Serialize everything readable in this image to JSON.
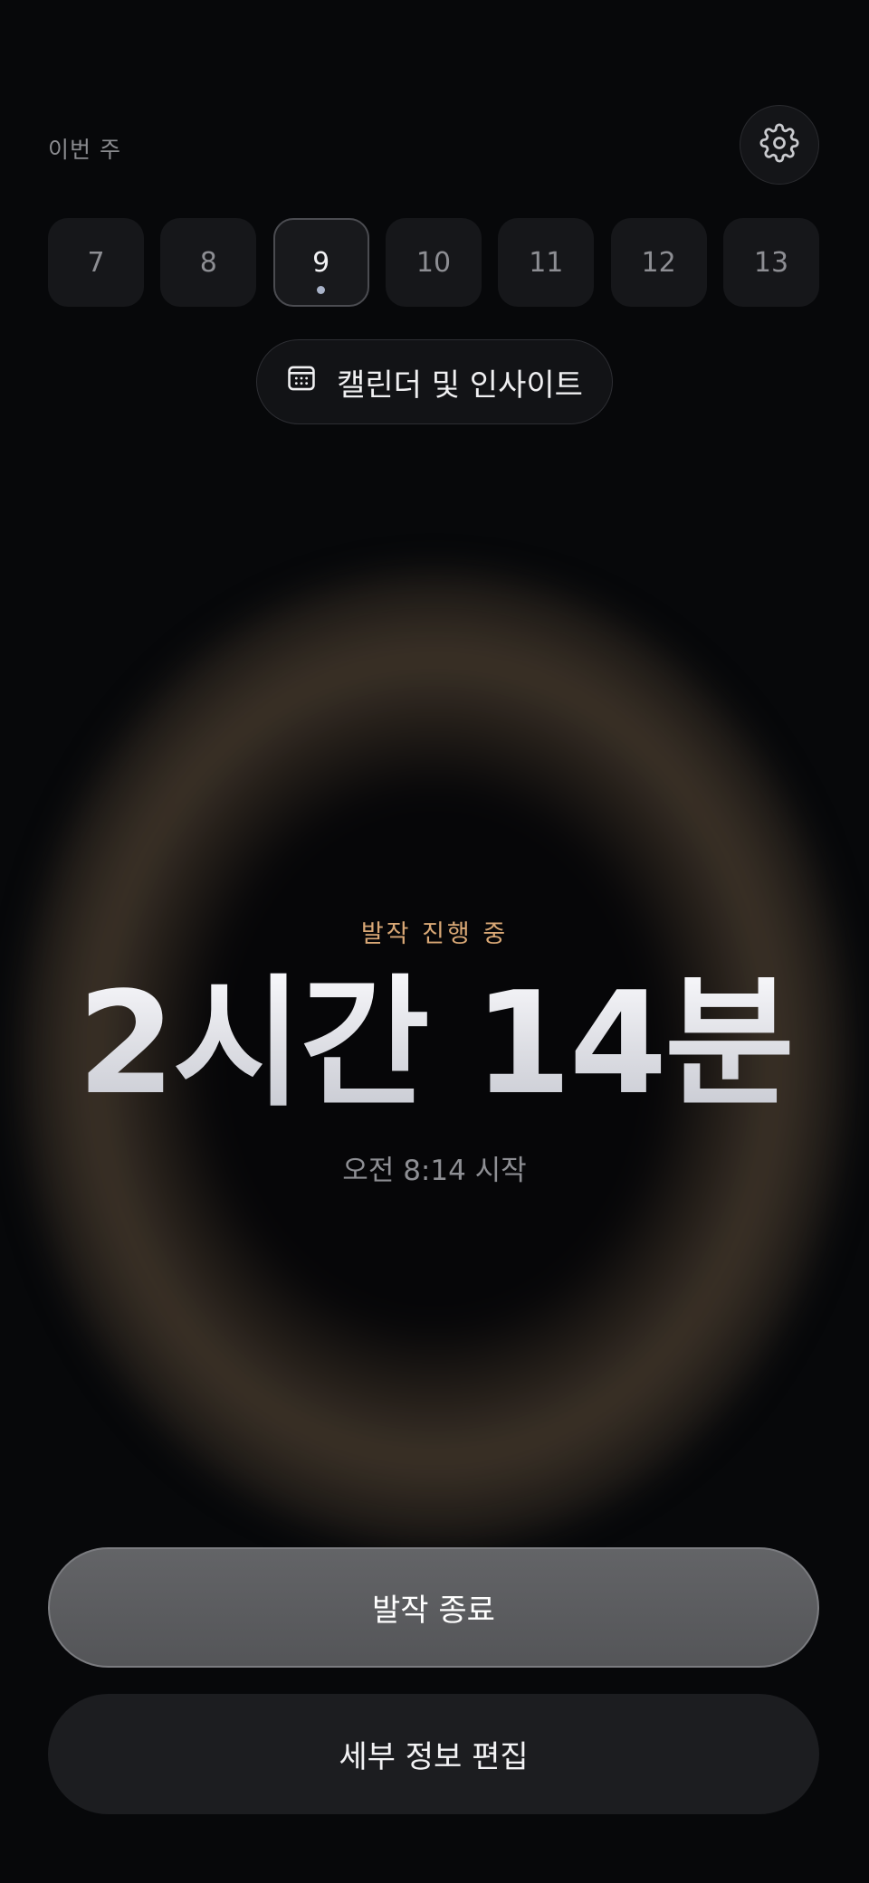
{
  "header": {
    "week_label": "이번 주",
    "settings_icon": "gear-icon"
  },
  "days": [
    {
      "label": "7",
      "active": false
    },
    {
      "label": "8",
      "active": false
    },
    {
      "label": "9",
      "active": true
    },
    {
      "label": "10",
      "active": false
    },
    {
      "label": "11",
      "active": false
    },
    {
      "label": "12",
      "active": false
    },
    {
      "label": "13",
      "active": false
    }
  ],
  "calendar_button": {
    "label": "캘린더 및 인사이트",
    "icon": "calendar-icon"
  },
  "episode": {
    "status": "발작 진행 중",
    "duration": "2시간 14분",
    "started": "오전 8:14 시작"
  },
  "actions": {
    "end_label": "발작 종료",
    "edit_label": "세부 정보 편집"
  },
  "colors": {
    "background": "#07080a",
    "accent": "#d9a876",
    "selected_dot": "#a9b3c9"
  }
}
